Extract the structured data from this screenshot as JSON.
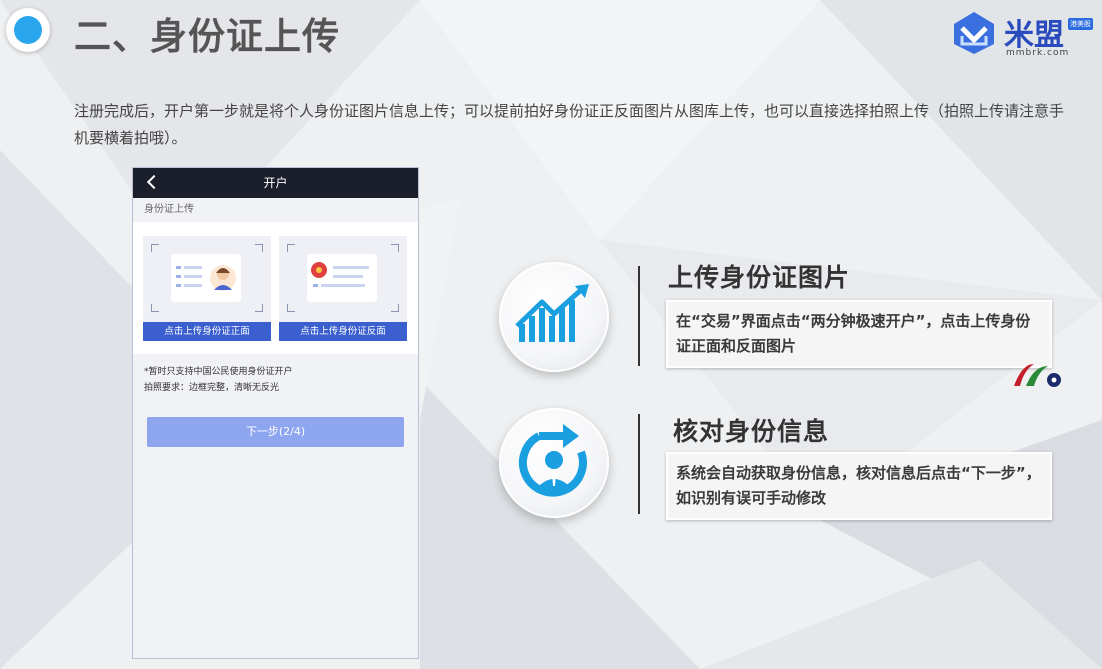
{
  "header": {
    "title": "二、身份证上传"
  },
  "logo": {
    "name": "米盟",
    "badge": "港美股",
    "url": "mmbrk.com"
  },
  "intro_text": "注册完成后，开户第一步就是将个人身份证图片信息上传；可以提前拍好身份证正反面图片从图库上传，也可以直接选择拍照上传（拍照上传请注意手机要横着拍哦）。",
  "phone": {
    "nav_title": "开户",
    "section_label": "身份证上传",
    "front_button": "点击上传身份证正面",
    "back_button": "点击上传身份证反面",
    "note_line1": "*暂时只支持中国公民使用身份证开户",
    "note_line2": "拍照要求：边框完整，清晰无反光",
    "next_button": "下一步(2/4)"
  },
  "steps": [
    {
      "title": "上传身份证图片",
      "description": "在“交易”界面点击“两分钟极速开户”，点击上传身份证正面和反面图片",
      "icon": "bar-chart-growth-icon"
    },
    {
      "title": "核对身份信息",
      "description": "系统会自动获取身份信息，核对信息后点击“下一步”，如识别有误可手动修改",
      "icon": "user-refresh-icon"
    }
  ],
  "colors": {
    "accent_blue": "#2aa6ee",
    "brand_blue": "#2a4bbd",
    "button_blue": "#3b5fcf",
    "next_button": "#8ea5f0"
  }
}
